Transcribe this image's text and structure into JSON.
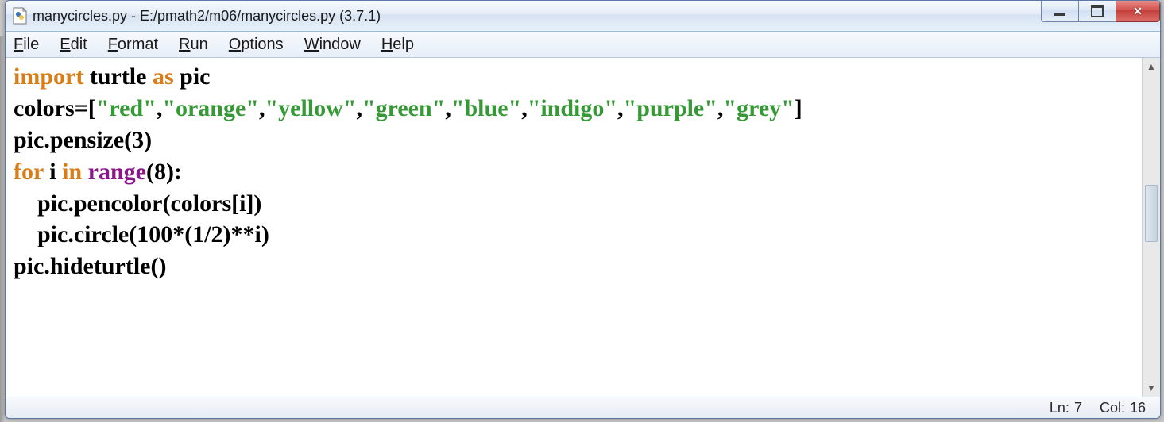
{
  "titlebar": {
    "title": "manycircles.py - E:/pmath2/m06/manycircles.py (3.7.1)"
  },
  "menubar": {
    "items": [
      {
        "uchar": "F",
        "rest": "ile"
      },
      {
        "uchar": "E",
        "rest": "dit"
      },
      {
        "uchar": "F",
        "rest": "ormat"
      },
      {
        "uchar": "R",
        "rest": "un"
      },
      {
        "uchar": "O",
        "rest": "ptions"
      },
      {
        "uchar": "W",
        "rest": "indow"
      },
      {
        "uchar": "H",
        "rest": "elp"
      }
    ]
  },
  "code": {
    "l1_import": "import",
    "l1_sp1": " turtle ",
    "l1_as": "as",
    "l1_sp2": " pic",
    "l2_a": "colors=[",
    "l2_s1": "\"red\"",
    "l2_c1": ",",
    "l2_s2": "\"orange\"",
    "l2_c2": ",",
    "l2_s3": "\"yellow\"",
    "l2_c3": ",",
    "l2_s4": "\"green\"",
    "l2_c4": ",",
    "l2_s5": "\"blue\"",
    "l2_c5": ",",
    "l2_s6": "\"indigo\"",
    "l2_c6": ",",
    "l2_s7": "\"purple\"",
    "l2_c7": ",",
    "l2_s8": "\"grey\"",
    "l2_b": "]",
    "l3": "pic.pensize(3)",
    "l4_for": "for",
    "l4_i": " i ",
    "l4_in": "in",
    "l4_sp": " ",
    "l4_range": "range",
    "l4_rest": "(8):",
    "l5": "    pic.pencolor(colors[i])",
    "l6": "    pic.circle(100*(1/2)**i)",
    "l7": "pic.hideturtle()"
  },
  "status": {
    "ln_label": "Ln:",
    "ln_value": "7",
    "col_label": "Col:",
    "col_value": "16"
  }
}
